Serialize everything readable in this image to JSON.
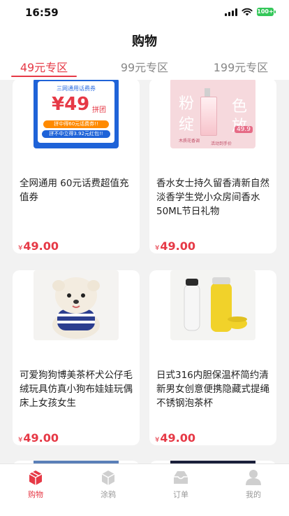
{
  "status_bar": {
    "time": "16:59",
    "battery": "100+"
  },
  "header": {
    "title": "购物"
  },
  "tabs": [
    {
      "label": "49元专区",
      "active": true
    },
    {
      "label": "99元专区",
      "active": false
    },
    {
      "label": "199元专区",
      "active": false
    }
  ],
  "products": [
    {
      "title": "全网通用 60元话费超值充值券",
      "currency": "¥",
      "price": "49.00",
      "image_text": {
        "header": "三网通用话费券",
        "price": "¥49",
        "tag": "拼团",
        "line1": "拼中得60元话费券!!",
        "line2": "拼不中立得3.92元红包!!"
      }
    },
    {
      "title": "香水女士持久留香清新自然淡香学生党小众房间香水50ML节日礼物",
      "currency": "¥",
      "price": "49.00",
      "image_text": {
        "chars": [
          "粉",
          "色",
          "绽",
          "放"
        ],
        "price_tag": "49.9",
        "caption1": "木质花香调",
        "caption2": "活动到手价"
      }
    },
    {
      "title": "可爱狗狗博美茶杯犬公仔毛绒玩具仿真小狗布娃娃玩偶床上女孩女生",
      "currency": "¥",
      "price": "49.00"
    },
    {
      "title": "日式316内胆保温杯简约清新男女创意便携隐藏式提绳不锈钢泡茶杯",
      "currency": "¥",
      "price": "49.00"
    }
  ],
  "tab_bar": [
    {
      "label": "购物",
      "icon": "shopping-box-icon",
      "active": true
    },
    {
      "label": "涂鸦",
      "icon": "box-icon",
      "active": false
    },
    {
      "label": "订单",
      "icon": "order-tray-icon",
      "active": false
    },
    {
      "label": "我的",
      "icon": "user-icon",
      "active": false
    }
  ],
  "colors": {
    "accent": "#e63946",
    "inactive": "#999999",
    "background": "#f2f2f2"
  }
}
